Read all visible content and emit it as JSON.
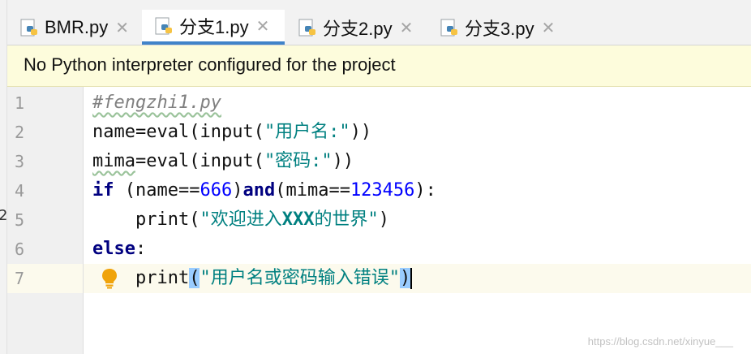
{
  "left_fragment": "2",
  "tabs": [
    {
      "label": "BMR.py",
      "active": false
    },
    {
      "label": "分支1.py",
      "active": true
    },
    {
      "label": "分支2.py",
      "active": false
    },
    {
      "label": "分支3.py",
      "active": false
    }
  ],
  "close_glyph": "✕",
  "banner": {
    "message": "No Python interpreter configured for the project"
  },
  "editor": {
    "line_numbers": [
      "1",
      "2",
      "3",
      "4",
      "5",
      "6",
      "7"
    ],
    "current_line": "7",
    "lines": {
      "l1": {
        "comment": "#fengzhi1.py"
      },
      "l2": {
        "a": "name",
        "b": "=eval(input(",
        "s": "\"用户名:\"",
        "c": "))"
      },
      "l3": {
        "a": "mima",
        "b": "=eval(input(",
        "s": "\"密码:\"",
        "c": "))"
      },
      "l4": {
        "kw_if": "if",
        "a": " (name==",
        "n1": "666",
        "b": ")",
        "kw_and": "and",
        "c": "(mima==",
        "n2": "123456",
        "d": "):"
      },
      "l5": {
        "a": "    print(",
        "s1": "\"欢迎进入",
        "s_bold": "XXX",
        "s2": "的世界\"",
        "c": ")"
      },
      "l6": {
        "kw_else": "else",
        "c": ":"
      },
      "l7": {
        "a": "    print",
        "p_open": "(",
        "s": "\"用户名或密码输入错误\"",
        "p_close": ")"
      }
    }
  },
  "icons": {
    "file": "python-file-icon",
    "hint": "lightbulb-icon"
  },
  "watermark": "https://blog.csdn.net/xinyue___"
}
